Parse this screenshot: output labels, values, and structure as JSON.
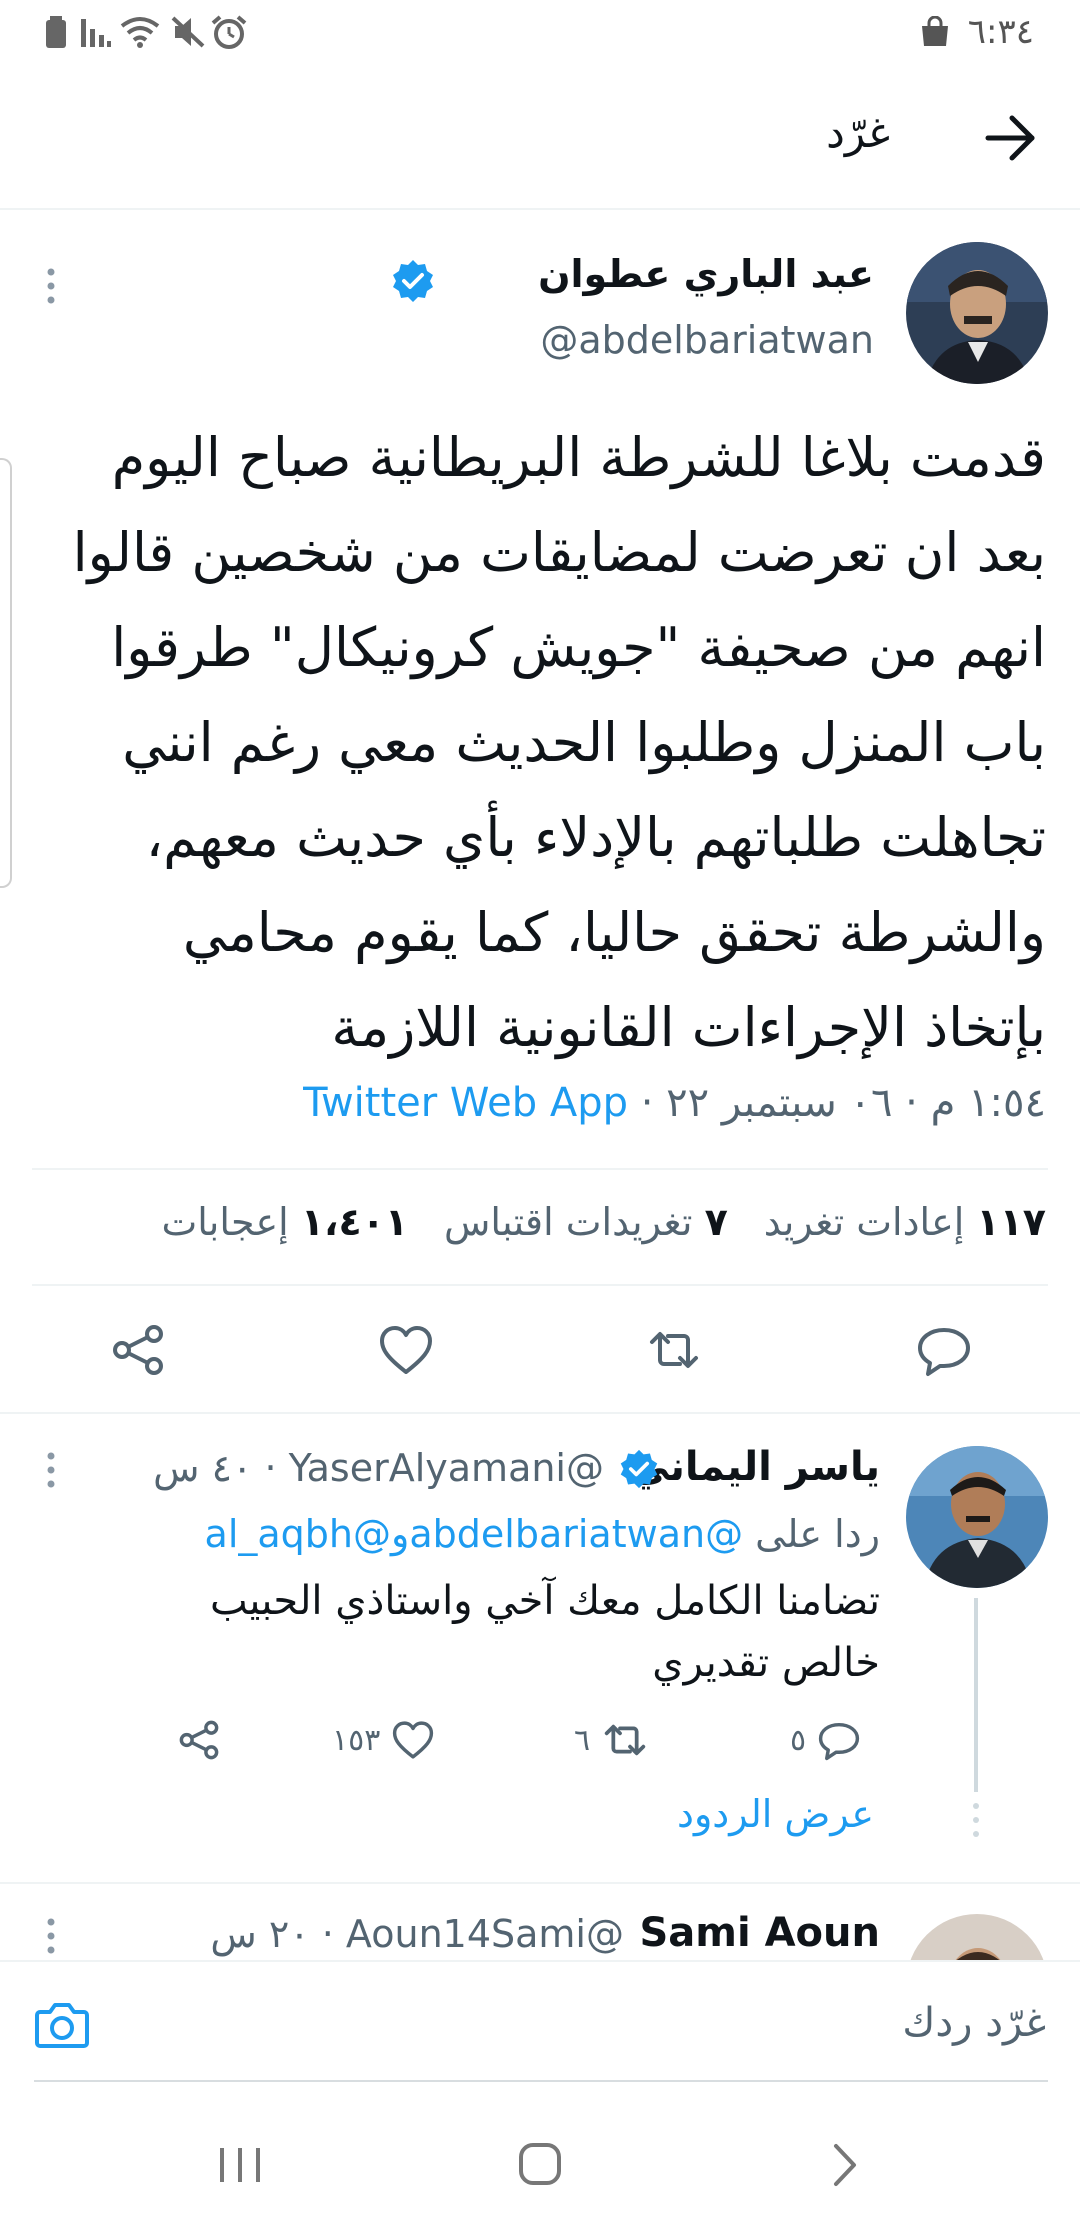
{
  "status_bar": {
    "time": "٦:٣٤",
    "icons": [
      "battery-icon",
      "signal-icon",
      "wifi-icon",
      "mute-icon",
      "alarm-icon",
      "shopping-bag-icon"
    ]
  },
  "header": {
    "title": "غرّد",
    "back_icon": "arrow-right-icon"
  },
  "tweet": {
    "author_name": "عبد الباري عطوان",
    "author_handle": "@abdelbariatwan",
    "verified": true,
    "text_lines": [
      "قدمت بلاغا للشرطة البريطانية صباح اليوم",
      "بعد ان تعرضت لمضايقات من شخصين قالوا",
      "انهم من صحيفة \"جويش كرونيكال\" طرقوا",
      "باب المنزل وطلبوا الحديث معي رغم انني",
      "تجاهلت طلباتهم بالإدلاء بأي حديث معهم،",
      "والشرطة تحقق حاليا، كما يقوم محامي",
      "بإتخاذ الإجراءات القانونية اللازمة"
    ],
    "timestamp": "١:٥٤ م · ٠٦ سبتمبر ٢٢ · ",
    "source": "Twitter Web App",
    "stats": {
      "retweets_count": "١١٧",
      "retweets_label": "إعادات تغريد",
      "quotes_count": "٧",
      "quotes_label": "تغريدات اقتباس",
      "likes_count": "١،٤٠١",
      "likes_label": "إعجابات"
    }
  },
  "reply": {
    "name": "ياسر اليماني",
    "verified": true,
    "handle_time": "@YaserAlyamani · ٤٠ س",
    "replying_to_label": "ردا على",
    "mention_1": "@abdelbariatwan",
    "mention_and": "و",
    "mention_2": "@al_aqbh",
    "text": "تضامنا الكامل معك آخي واستاذي الحبيب خالص تقديري",
    "reply_count": "٥",
    "retweet_count": "٦",
    "like_count": "١٥٣",
    "show_replies": "عرض الردود"
  },
  "reply2": {
    "name": "Sami Aoun",
    "handle_time": "@Aoun14Sami · ٢٠ س"
  },
  "compose": {
    "placeholder": "غرّد ردك",
    "camera_icon": "camera-icon"
  },
  "nav_bar": {
    "icons": [
      "recents-icon",
      "home-icon",
      "back-icon"
    ]
  },
  "colors": {
    "accent": "#1d9bf0",
    "text": "#0f1419",
    "secondary": "#536471"
  }
}
